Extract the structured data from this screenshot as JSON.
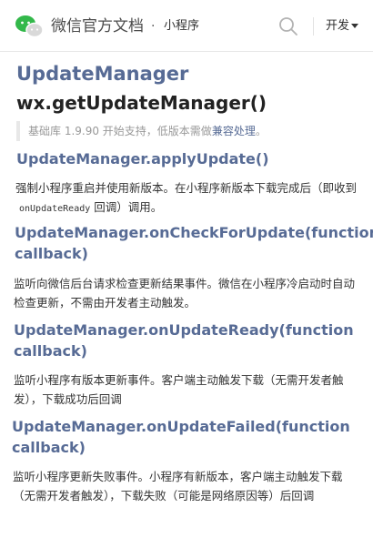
{
  "header": {
    "brand": "微信官方文档",
    "separator": "·",
    "subtitle": "小程序",
    "menu_label": "开发",
    "logo_icon": "wechat-logo-icon",
    "search_icon": "search-icon",
    "accent_color": "#33b84a"
  },
  "page": {
    "title": "UpdateManager",
    "api_title": "wx.getUpdateManager()",
    "note": {
      "prefix": "基础库 1.9.90 开始支持，低版本需做",
      "link": "兼容处理",
      "suffix": "。"
    }
  },
  "methods": [
    {
      "name": "UpdateManager.applyUpdate()",
      "desc_before": "强制小程序重启并使用新版本。在小程序新版本下载完成后（即收到",
      "desc_code": "onUpdateReady",
      "desc_after": "回调）调用。"
    },
    {
      "name_line1": "UpdateManager.onCheckForUpdate(function",
      "name_line2": "callback)",
      "desc": "监听向微信后台请求检查更新结果事件。微信在小程序冷启动时自动检查更新，不需由开发者主动触发。"
    },
    {
      "name_line1": "UpdateManager.onUpdateReady(function",
      "name_line2": "callback)",
      "desc": "监听小程序有版本更新事件。客户端主动触发下载（无需开发者触发），下载成功后回调"
    },
    {
      "name_line1": "UpdateManager.onUpdateFailed(function",
      "name_line2": "callback)",
      "desc": "监听小程序更新失败事件。小程序有新版本，客户端主动触发下载（无需开发者触发），下载失败（可能是网络原因等）后回调"
    }
  ]
}
